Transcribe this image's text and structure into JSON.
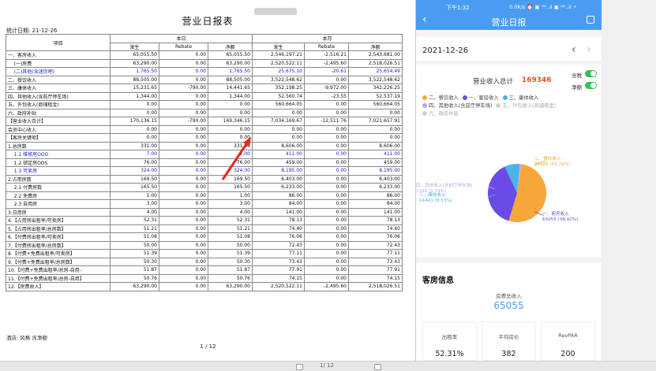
{
  "report": {
    "title": "营业日报表",
    "date": "统计日期:   21-12-26",
    "head_item": "项目",
    "head_day": "本日",
    "head_month": "本月",
    "sub": [
      "发生",
      "Rebate",
      "净额",
      "发生",
      "Rebate",
      "净额"
    ],
    "rows": [
      {
        "n": "一、客房收入",
        "v": [
          "65,055.50",
          "0.00",
          "65,055.50",
          "2,546,197.21",
          "-2,516.21",
          "2,543,681.00"
        ],
        "b": false
      },
      {
        "n": "    (一)房费",
        "v": [
          "63,290.00",
          "0.00",
          "63,290.00",
          "2,520,522.11",
          "-2,495.60",
          "2,518,026.51"
        ],
        "b": false
      },
      {
        "n": "    (二)其他(含迷你吧)",
        "v": [
          "1,765.50",
          "0.00",
          "1,765.50",
          "25,675.10",
          "-20.61",
          "25,654.49"
        ],
        "b": true
      },
      {
        "n": "二、餐饮收入",
        "v": [
          "88,505.00",
          "0.00",
          "88,505.00",
          "3,522,548.62",
          "0.00",
          "3,522,548.62"
        ],
        "b": false
      },
      {
        "n": "三、康体收入",
        "v": [
          "15,231.65",
          "-790.00",
          "14,441.65",
          "352,198.25",
          "-9,972.00",
          "342,226.25"
        ],
        "b": false
      },
      {
        "n": "四、其他收入(含前厅停车场)",
        "v": [
          "1,344.00",
          "0.00",
          "1,344.00",
          "52,560.74",
          "-23.55",
          "52,537.19"
        ],
        "b": false
      },
      {
        "n": "五、外包收入(商铺租金)",
        "v": [
          "0.00",
          "0.00",
          "0.00",
          "560,664.05",
          "0.00",
          "560,664.05"
        ],
        "b": false
      },
      {
        "n": "六、政府补贴",
        "v": [
          "0.00",
          "0.00",
          "0.00",
          "0.00",
          "0.00",
          "0.00"
        ],
        "b": false
      },
      {
        "n": "【营业收入合计】",
        "v": [
          "170,136.15",
          "-790.00",
          "169,346.15",
          "7,034,169.67",
          "-12,511.76",
          "7,021,657.91"
        ],
        "b": false
      },
      {
        "n": "会员中心收入",
        "v": [
          "0.00",
          "0.00",
          "0.00",
          "0.00",
          "0.00",
          "0.00"
        ],
        "b": false
      },
      {
        "n": "【客房关键项】",
        "v": [
          "0.00",
          "0.00",
          "0.00",
          "0.00",
          "0.00",
          "0.00"
        ],
        "b": false
      },
      {
        "n": "1.总房数",
        "v": [
          "331.00",
          "0.00",
          "331.00",
          "8,606.00",
          "0.00",
          "8,606.00"
        ],
        "b": false
      },
      {
        "n": "    1.1 维修房OOO",
        "v": [
          "7.00",
          "0.00",
          "7.00",
          "411.00",
          "0.00",
          "411.00"
        ],
        "b": true
      },
      {
        "n": "    1.2 锁定房OOS",
        "v": [
          "76.00",
          "0.00",
          "76.00",
          "459.00",
          "0.00",
          "459.00"
        ],
        "b": false
      },
      {
        "n": "    1.3 可卖房",
        "v": [
          "324.00",
          "0.00",
          "324.00",
          "8,195.00",
          "0.00",
          "8,195.00"
        ],
        "b": true
      },
      {
        "n": "2.占用房数",
        "v": [
          "169.50",
          "0.00",
          "169.50",
          "6,403.00",
          "0.00",
          "6,403.00"
        ],
        "b": false
      },
      {
        "n": "    2.1 付费房数",
        "v": [
          "165.50",
          "0.00",
          "165.50",
          "6,233.00",
          "0.00",
          "6,233.00"
        ],
        "b": false
      },
      {
        "n": "    2.2 免费房",
        "v": [
          "1.00",
          "0.00",
          "1.00",
          "86.00",
          "0.00",
          "86.00"
        ],
        "b": false
      },
      {
        "n": "    2.3 自用房",
        "v": [
          "3.00",
          "0.00",
          "3.00",
          "84.00",
          "0.00",
          "84.00"
        ],
        "b": false
      },
      {
        "n": "3.日用房",
        "v": [
          "4.00",
          "0.00",
          "4.00",
          "141.00",
          "0.00",
          "141.00"
        ],
        "b": false
      },
      {
        "n": "4.【占用房出租率/可卖房】",
        "v": [
          "52.31",
          "0.00",
          "52.31",
          "78.13",
          "0.00",
          "78.13"
        ],
        "b": false
      },
      {
        "n": "5.【占用房出租率/总房数】",
        "v": [
          "51.21",
          "0.00",
          "51.21",
          "74.40",
          "0.00",
          "74.40"
        ],
        "b": false
      },
      {
        "n": "6.【付费房出租率/可卖房】",
        "v": [
          "51.08",
          "0.00",
          "51.08",
          "76.06",
          "0.00",
          "76.06"
        ],
        "b": false
      },
      {
        "n": "7.【付费房出租率/总房数】",
        "v": [
          "50.00",
          "0.00",
          "50.00",
          "72.43",
          "0.00",
          "72.43"
        ],
        "b": false
      },
      {
        "n": "8.【付费+免费出租率/可卖房】",
        "v": [
          "51.39",
          "0.00",
          "51.39",
          "77.11",
          "0.00",
          "77.11"
        ],
        "b": false
      },
      {
        "n": "9.【付费+免费出租率/总房数】",
        "v": [
          "50.30",
          "0.00",
          "50.30",
          "73.43",
          "0.00",
          "73.43"
        ],
        "b": false
      },
      {
        "n": "10.【付费+免费出租率/总房-自用-",
        "v": [
          "51.87",
          "0.00",
          "51.87",
          "77.91",
          "0.00",
          "77.91"
        ],
        "b": false
      },
      {
        "n": "11.【付费+免费出租率/总房-自用】",
        "v": [
          "50.76",
          "0.00",
          "50.76",
          "74.15",
          "0.00",
          "74.15"
        ],
        "b": false
      },
      {
        "n": "12.【房费收入】",
        "v": [
          "63,290.00",
          "0.00",
          "63,290.00",
          "2,520,522.11",
          "-2,495.60",
          "2,518,026.51"
        ],
        "b": false
      }
    ],
    "footer": "酒店:                    风格 含净额",
    "page": "1 / 12"
  },
  "app": {
    "status_time": "下午1:32",
    "status_icons": "0.0K/s ⏰ ▣ ᴴᴰ..ıl ▣ ᴴᴰ..ıl ⚡",
    "title": "营业日报",
    "date": "2021-12-26",
    "total_label": "营业收入总计",
    "total_value": "169346",
    "toggle_tax": "含税",
    "toggle_net": "净额",
    "legend": [
      {
        "label": "二、餐饮收入",
        "color": "#f7a73a"
      },
      {
        "label": "一、客房收入",
        "color": "#6a4be6"
      },
      {
        "label": "三、康体收入",
        "color": "#4bb4e6"
      },
      {
        "label": "四、其他收入(含前厅停车场)",
        "color": "#b6a9ef"
      },
      {
        "label": "五、外包收入(商铺租金)",
        "color": "#d3d3d3"
      },
      {
        "label": "六、政府补贴",
        "color": "#cfcfcf"
      }
    ],
    "pie_labels": {
      "food_name": "二、餐饮收入",
      "food_val": "88505 (52.26%)",
      "room_name": "一、客房收入",
      "room_val": "65055 (38.42%)",
      "spa_name": "三、康体收入",
      "spa_val": "14441 (8.53%)",
      "other_name": "四、其他收入(含前厅停车场)",
      "other_val": "1344 (0.79%)"
    },
    "section_title": "客房信息",
    "room_total_label": "房费总收入",
    "room_total_value": "65055",
    "cards": [
      {
        "label": "出租率",
        "value": "52.31%"
      },
      {
        "label": "平均房价",
        "value": "382"
      },
      {
        "label": "RevPAR",
        "value": "200"
      }
    ]
  },
  "viewer": {
    "page_info": "1/ 12"
  },
  "chart_data": {
    "type": "pie",
    "title": "营业收入总计 169346",
    "categories": [
      "二、餐饮收入",
      "一、客房收入",
      "三、康体收入",
      "四、其他收入(含前厅停车场)"
    ],
    "values": [
      88505,
      65055,
      14441,
      1344
    ],
    "percents": [
      52.26,
      38.42,
      8.53,
      0.79
    ],
    "colors": [
      "#f7a73a",
      "#6a4be6",
      "#4bb4e6",
      "#b6a9ef"
    ],
    "legend": "top"
  }
}
